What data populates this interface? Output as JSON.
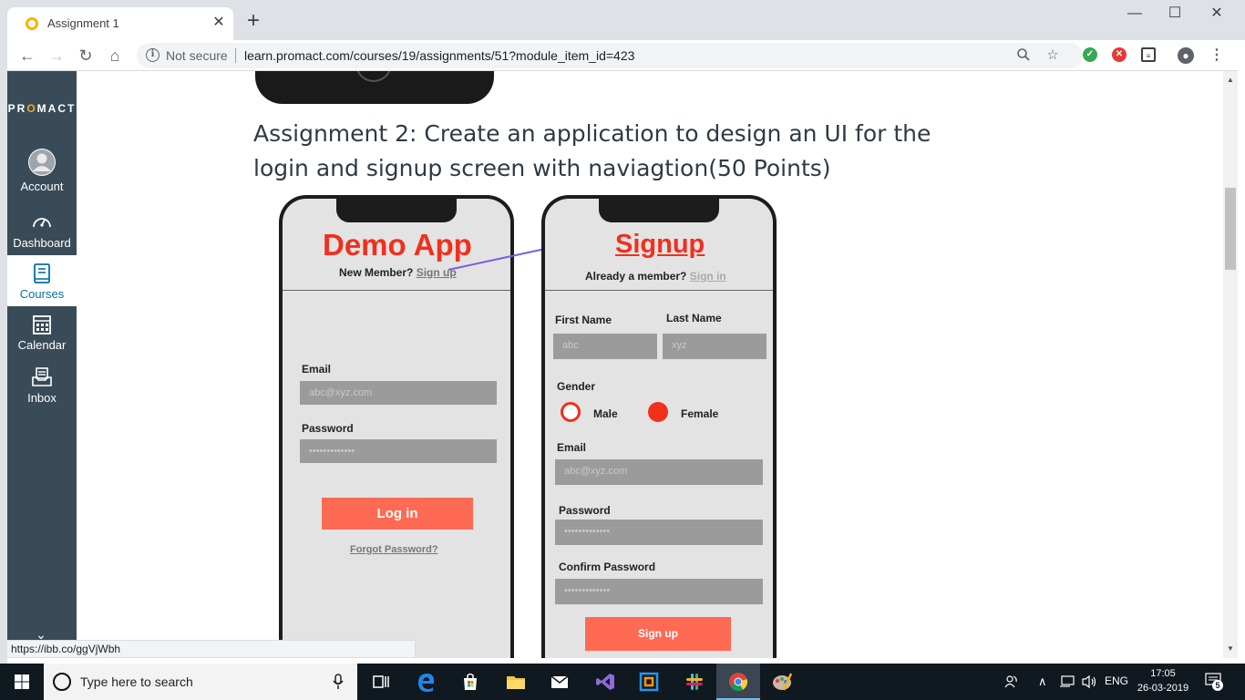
{
  "browser": {
    "tab_title": "Assignment 1",
    "tab_close": "✕",
    "new_tab": "+",
    "window_controls": {
      "minimize": "—",
      "maximize": "☐",
      "close": "✕"
    },
    "nav": {
      "back": "←",
      "forward": "→",
      "reload": "↻",
      "home": "⌂"
    },
    "security_label": "Not secure",
    "url": "learn.promact.com/courses/19/assignments/51?module_item_id=423",
    "status_url": "https://ibb.co/ggVjWbh"
  },
  "sidebar": {
    "brand_pre": "PR",
    "brand_o": "O",
    "brand_post": "MACT",
    "items": [
      {
        "label": "Account",
        "icon": "account-icon"
      },
      {
        "label": "Dashboard",
        "icon": "dashboard-icon"
      },
      {
        "label": "Courses",
        "icon": "courses-icon",
        "active": true
      },
      {
        "label": "Calendar",
        "icon": "calendar-icon"
      },
      {
        "label": "Inbox",
        "icon": "inbox-icon"
      }
    ]
  },
  "content": {
    "heading": "Assignment 2: Create an application to design an UI for the login and signup screen with naviagtion(50 Points)",
    "login_mock": {
      "title": "Demo App",
      "new_member": "New Member?",
      "signup_link": "Sign up",
      "email_label": "Email",
      "email_placeholder": "abc@xyz.com",
      "password_label": "Password",
      "password_placeholder": "•••••••••••••",
      "login_button": "Log in",
      "forgot_link": "Forgot Password?"
    },
    "signup_mock": {
      "title": "Signup",
      "already_member": "Already a member?",
      "signin_link": "Sign in",
      "first_name_label": "First Name",
      "last_name_label": "Last Name",
      "first_name_value": "abc",
      "last_name_value": "xyz",
      "gender_label": "Gender",
      "male_label": "Male",
      "female_label": "Female",
      "email_label": "Email",
      "email_placeholder": "abc@xyz.com",
      "password_label": "Password",
      "password_placeholder": "•••••••••••••",
      "confirm_label": "Confirm Password",
      "confirm_placeholder": "•••••••••••••",
      "signup_button": "Sign up"
    }
  },
  "taskbar": {
    "search_placeholder": "Type here to search",
    "language": "ENG",
    "time": "17:05",
    "date": "26-03-2019",
    "notification_count": "5"
  },
  "colors": {
    "sidebar_bg": "#394b58",
    "accent_red": "#f0301d",
    "button_coral": "#ff6a55",
    "active_blue": "#0770a3"
  }
}
